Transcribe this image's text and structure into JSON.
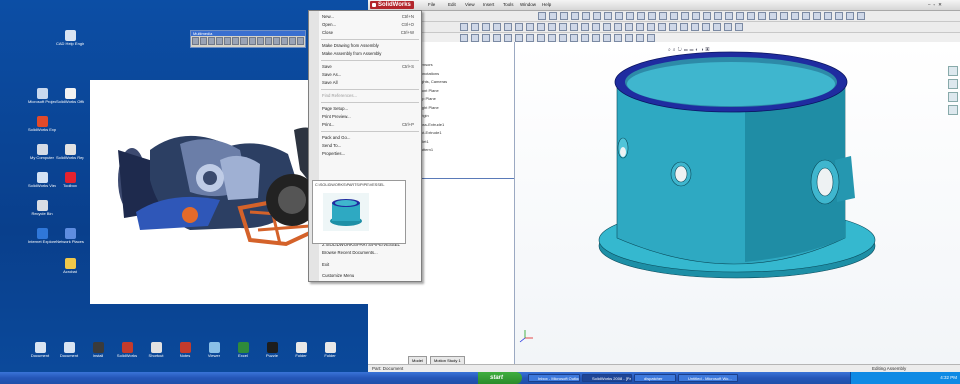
{
  "desktop": {
    "icons_left": [
      {
        "label": "CAD Help Engineering",
        "color": "#d9e4f2"
      },
      {
        "label": "Microsoft Project",
        "color": "#c8d8ee"
      },
      {
        "label": "SolidWorks Explorer",
        "color": "#e24a2a"
      },
      {
        "label": "My Computer",
        "color": "#d4dbe6"
      },
      {
        "label": "SolidWorks Viewer",
        "color": "#d3e2f5"
      },
      {
        "label": "Recycle Bin",
        "color": "#d8dde5"
      },
      {
        "label": "Internet Explorer",
        "color": "#2f77d9"
      },
      {
        "label": "Acrobat",
        "color": "#f0c84a"
      }
    ],
    "icons_mid": [
      {
        "label": "SolidWorks Office",
        "color": "#f2f2f2"
      },
      {
        "label": "SolidWorks Reports",
        "color": "#e2e2e2"
      },
      {
        "label": "Toolbox",
        "color": "#e4222e"
      },
      {
        "label": "Network Places",
        "color": "#5e8de0"
      }
    ],
    "icons_bottom": [
      {
        "label": "Document",
        "color": "#d9e4f2"
      },
      {
        "label": "Document",
        "color": "#d9e4f2"
      },
      {
        "label": "Install",
        "color": "#3b3b3b"
      },
      {
        "label": "SolidWorks",
        "color": "#c43b2c"
      },
      {
        "label": "Shortcut",
        "color": "#e2e2e2"
      },
      {
        "label": "Notes",
        "color": "#c43b2c"
      },
      {
        "label": "Viewer",
        "color": "#8ac0e8"
      },
      {
        "label": "Excel",
        "color": "#2f8a3b"
      },
      {
        "label": "Puzzle",
        "color": "#1d1d1d"
      },
      {
        "label": "Folder",
        "color": "#e8e8e8"
      },
      {
        "label": "Folder",
        "color": "#e8e8e8"
      }
    ],
    "mini_toolbar_title": "Multimedia"
  },
  "solidworks": {
    "logo": "SolidWorks",
    "menus": [
      "File",
      "Edit",
      "View",
      "Insert",
      "Tools",
      "Window",
      "Help"
    ],
    "status_left": "Part: Document",
    "status_right": "Editing Assembly",
    "tree_lines": [
      "Sensors",
      "Annotations",
      "Lights, Cameras",
      "Front Plane",
      "Top Plane",
      "Right Plane",
      "Origin",
      "Boss-Extrude1",
      "Cut-Extrude1",
      "Fillet1",
      "Pattern1"
    ],
    "tabs": [
      "Model",
      "Motion Study 1"
    ]
  },
  "file_menu": {
    "items": [
      {
        "label": "New...",
        "shortcut": "Ctrl+N"
      },
      {
        "label": "Open...",
        "shortcut": "Ctrl+O"
      },
      {
        "label": "Close",
        "shortcut": "Ctrl+W"
      },
      {
        "sep": true
      },
      {
        "label": "Make Drawing from Assembly",
        "shortcut": ""
      },
      {
        "label": "Make Assembly from Assembly",
        "shortcut": ""
      },
      {
        "sep": true
      },
      {
        "label": "Save",
        "shortcut": "Ctrl+S"
      },
      {
        "label": "Save As...",
        "shortcut": ""
      },
      {
        "label": "Save All",
        "shortcut": ""
      },
      {
        "sep": true
      },
      {
        "label": "Find References...",
        "shortcut": "",
        "disabled": true
      },
      {
        "sep": true
      },
      {
        "label": "Page Setup...",
        "shortcut": ""
      },
      {
        "label": "Print Preview...",
        "shortcut": ""
      },
      {
        "label": "Print...",
        "shortcut": "Ctrl+P"
      },
      {
        "sep": true
      },
      {
        "label": "Pack and Go...",
        "shortcut": ""
      },
      {
        "label": "Send To...",
        "shortcut": ""
      },
      {
        "label": "Properties...",
        "shortcut": ""
      }
    ],
    "recent_path": "C:\\SOLIDWORKS\\PARTS\\PIPE\\VESSEL",
    "recent_path_bottom": "2:\\SOLIDWORKS\\PARTS\\PIPE\\VESSEL",
    "browse_recent": "Browse Recent Documents...",
    "exit": "Exit",
    "customize": "Customize Menu"
  },
  "taskbar": {
    "start": "start",
    "tasks": [
      "Inbox - Microsoft Outlook",
      "SolidWorks 2008 - [Pa...",
      "dispatcher",
      "Untitled - Microsoft Wo..."
    ],
    "clock": "4:32 PM"
  }
}
